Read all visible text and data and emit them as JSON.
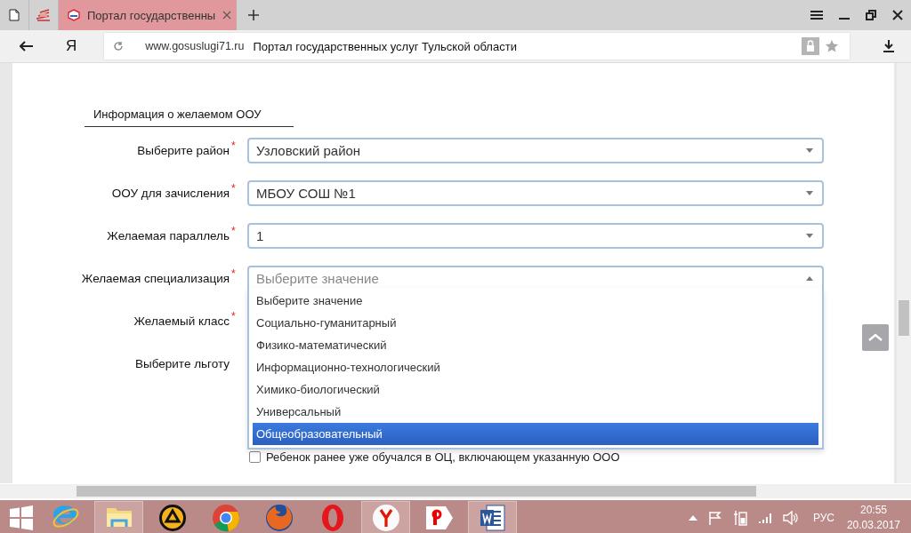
{
  "browser": {
    "tabs": [
      {
        "title": "Портал государственны",
        "selected": true
      }
    ],
    "yandex_button": "Я",
    "address": {
      "domain": "www.gosuslugi71.ru",
      "title": "Портал государственных услуг Тульской области"
    }
  },
  "form": {
    "section_title": "Информация о желаемом ООУ",
    "fields": [
      {
        "label": "Выберите район",
        "required_mark": "*",
        "kind": "select",
        "value": "Узловский район"
      },
      {
        "label": "ООУ для зачисления",
        "required_mark": "*",
        "kind": "select",
        "value": "МБОУ СОШ №1"
      },
      {
        "label": "Желаемая параллель",
        "required_mark": "*",
        "kind": "select",
        "value": "1"
      },
      {
        "label": "Желаемая специализация",
        "required_mark": "*",
        "kind": "select",
        "placeholder": "Выберите значение",
        "expanded": true,
        "options": [
          {
            "text": "Выберите значение",
            "selected": false
          },
          {
            "text": "Социально-гуманитарный",
            "selected": false
          },
          {
            "text": "Физико-математический",
            "selected": false
          },
          {
            "text": "Информационно-технологический",
            "selected": false
          },
          {
            "text": "Химико-биологический",
            "selected": false
          },
          {
            "text": "Универсальный",
            "selected": false
          },
          {
            "text": "Общеобразовательный",
            "selected": true
          }
        ]
      },
      {
        "label": "Желаемый класс",
        "required_mark": "*",
        "kind": "covered"
      },
      {
        "label": "Выберите льготу",
        "kind": "covered"
      }
    ],
    "checkbox": {
      "label": "Ребенок ранее уже обучался в ОЦ, включающем указанную ООО",
      "checked": false
    }
  },
  "taskbar": {
    "apps": [
      {
        "kind": "ie",
        "active": false
      },
      {
        "kind": "explorer",
        "active": true
      },
      {
        "kind": "aimp",
        "active": false
      },
      {
        "kind": "chrome",
        "active": false
      },
      {
        "kind": "firefox",
        "active": false
      },
      {
        "kind": "opera",
        "active": false
      },
      {
        "kind": "yandex",
        "active": true
      },
      {
        "kind": "ya",
        "active": false
      },
      {
        "kind": "word",
        "active": true
      }
    ],
    "tray": {
      "language": "РУС",
      "time": "20:55",
      "date": "20.03.2017"
    }
  }
}
